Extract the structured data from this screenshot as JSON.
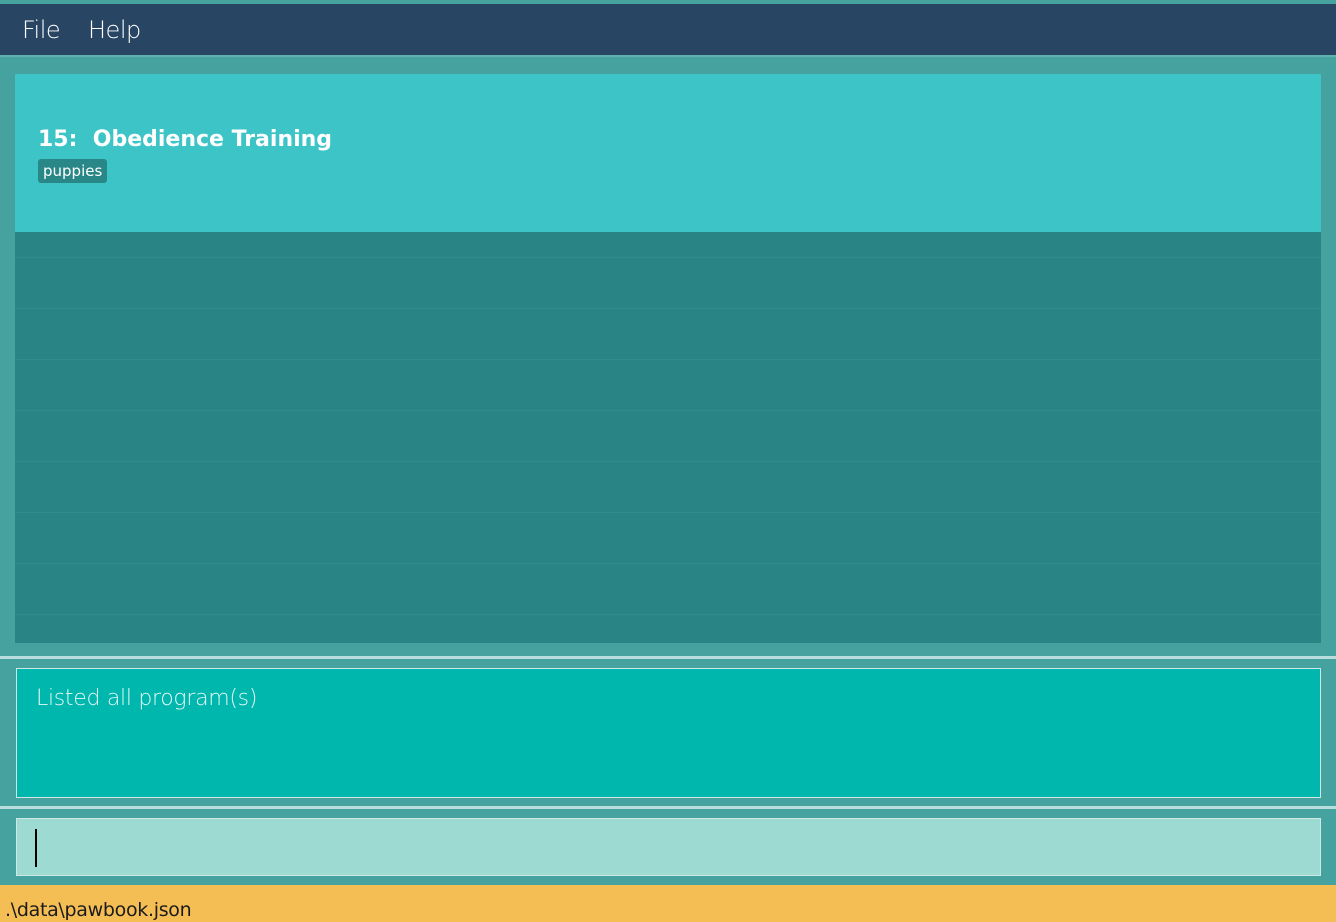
{
  "menu": {
    "file_label": "File",
    "help_label": "Help"
  },
  "program_list": {
    "selected_item": {
      "index": "15:",
      "name": "Obedience Training",
      "tag": "puppies"
    }
  },
  "result_display": {
    "text": "Listed all program(s)"
  },
  "command_box": {
    "value": ""
  },
  "status_bar": {
    "save_path": ".\\data\\pawbook.json"
  },
  "colors": {
    "menubar": "#284564",
    "background": "#45A29E",
    "list_background": "#298585",
    "selected_card": "#3CC4C6",
    "tag_background": "#2A8787",
    "result_background": "#00B7AD",
    "command_background": "#9DDAD2",
    "status_bar": "#F5BE55"
  }
}
